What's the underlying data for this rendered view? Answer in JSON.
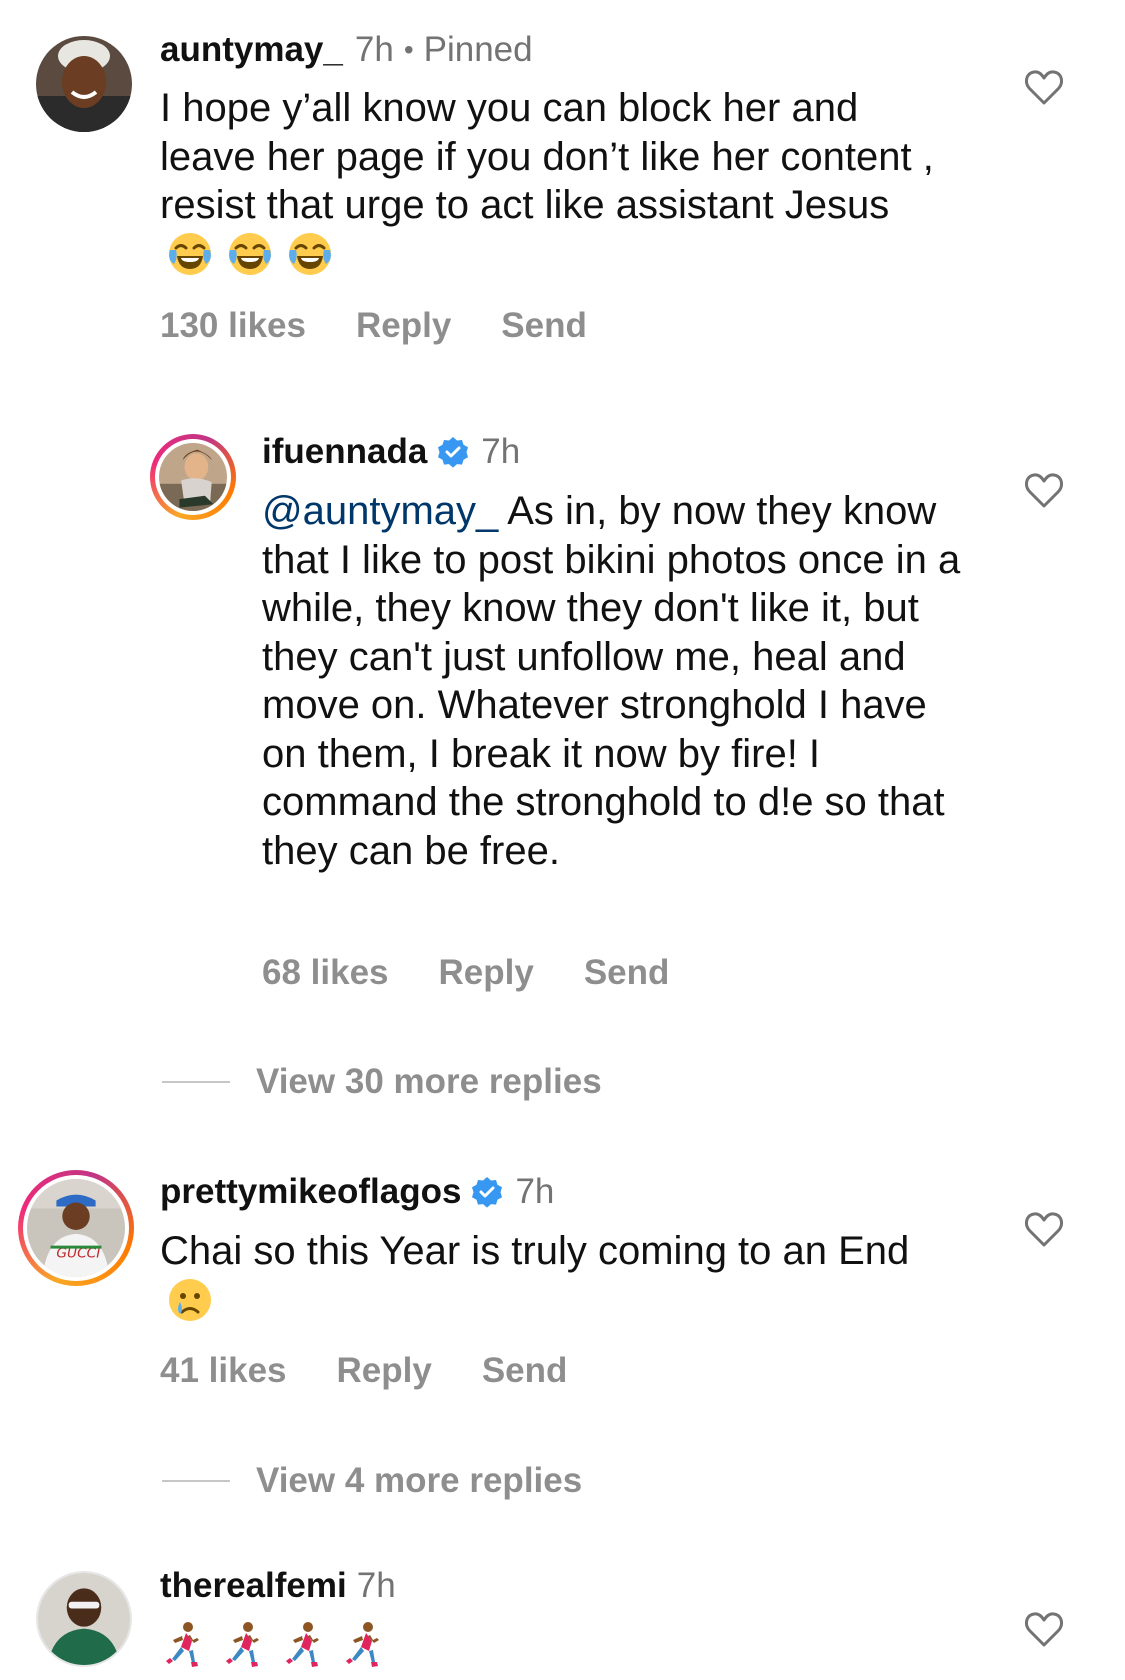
{
  "comments": [
    {
      "username": "auntymay_",
      "time": "7h",
      "pinned": "Pinned",
      "text": "I hope y’all know you can block her and leave her page if you don’t like her content , resist that urge to act like assistant Jesus",
      "emojis": [
        "face-with-tears-of-joy",
        "face-with-tears-of-joy",
        "face-with-tears-of-joy"
      ],
      "likes": "130 likes",
      "reply": "Reply",
      "send": "Send"
    },
    {
      "username": "ifuennada",
      "verified": true,
      "time": "7h",
      "mention": "@auntymay_",
      "text": "As in, by now they know that I like to post bikini photos once in a while, they know they don't like it, but they can't just unfollow me, heal and move on. Whatever stronghold I have on them, I break it now by fire! I command the stronghold to d!e so that they can be free.",
      "likes": "68 likes",
      "reply": "Reply",
      "send": "Send"
    },
    {
      "username": "prettymikeoflagos",
      "verified": true,
      "time": "7h",
      "text": "Chai so this Year is truly coming to an End",
      "emojis": [
        "crying-face"
      ],
      "likes": "41 likes",
      "reply": "Reply",
      "send": "Send"
    },
    {
      "username": "therealfemi",
      "time": "7h",
      "emojis": [
        "person-running",
        "person-running",
        "person-running",
        "person-running"
      ]
    }
  ],
  "view_more": [
    {
      "label": "View 30 more replies"
    },
    {
      "label": "View 4 more replies"
    }
  ],
  "colors": {
    "verified_badge": "#3897f0",
    "mention": "#00376b",
    "secondary_text": "#8e8e8e",
    "story_ring_start": "#f9a825",
    "story_ring_end": "#c13584"
  }
}
